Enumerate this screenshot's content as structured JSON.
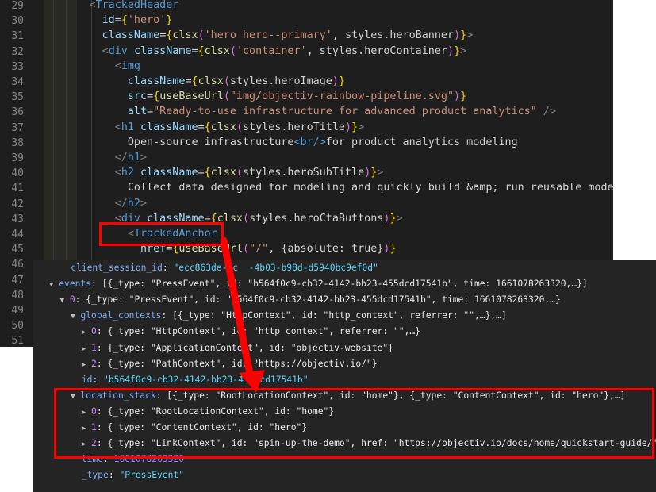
{
  "editor": {
    "line_numbers": [
      "29",
      "30",
      "31",
      "32",
      "33",
      "34",
      "35",
      "36",
      "37",
      "38",
      "39",
      "40",
      "41",
      "42",
      "43",
      "44",
      "45",
      "46",
      "47",
      "48",
      "49",
      "50",
      "51"
    ],
    "lines": [
      {
        "pre": "        ",
        "tag_open": "<",
        "tag": "TrackedHeader"
      },
      {
        "pre": "          ",
        "attr": "id",
        "eq": "=",
        "lb": "{",
        "str": "'hero'",
        "rb": "}"
      },
      {
        "pre": "          ",
        "attr": "className",
        "eq": "=",
        "lb": "{",
        "fn": "clsx",
        "p1": "(",
        "str": "'hero hero--primary'",
        "comma": ", ",
        "ref": "styles.heroBanner",
        "p2": ")",
        "rb": "}",
        "close": ">"
      },
      {
        "pre": "          ",
        "tag_open": "<",
        "tag": "div",
        "attr": "className",
        "eq": "=",
        "lb": "{",
        "fn": "clsx",
        "p1": "(",
        "str": "'container'",
        "comma": ", ",
        "ref": "styles.heroContainer",
        "p2": ")",
        "rb": "}",
        "close": ">"
      },
      {
        "pre": "            ",
        "tag_open": "<",
        "tag": "img"
      },
      {
        "pre": "              ",
        "attr": "className",
        "eq": "=",
        "lb": "{",
        "fn": "clsx",
        "p1": "(",
        "ref": "styles.heroImage",
        "p2": ")",
        "rb": "}"
      },
      {
        "pre": "              ",
        "attr": "src",
        "eq": "=",
        "lb": "{",
        "fn": "useBaseUrl",
        "p1": "(",
        "str": "\"img/objectiv-rainbow-pipeline.svg\"",
        "p2": ")",
        "rb": "}"
      },
      {
        "pre": "              ",
        "attr": "alt",
        "eq": "=",
        "str": "\"Ready-to-use infrastructure for advanced product analytics\"",
        "close": " />"
      },
      {
        "pre": "            ",
        "tag_open": "<",
        "tag": "h1",
        "attr": "className",
        "eq": "=",
        "lb": "{",
        "fn": "clsx",
        "p1": "(",
        "ref": "styles.heroTitle",
        "p2": ")",
        "rb": "}",
        "close": ">"
      },
      {
        "pre": "              ",
        "text": "Open-source infrastructure",
        "inner_tag": "<br/>",
        "text2": "for product analytics modeling"
      },
      {
        "pre": "            ",
        "tag_open": "</",
        "tag": "h1",
        "close": ">"
      },
      {
        "pre": "            ",
        "tag_open": "<",
        "tag": "h2",
        "attr": "className",
        "eq": "=",
        "lb": "{",
        "fn": "clsx",
        "p1": "(",
        "ref": "styles.heroSubTitle",
        "p2": ")",
        "rb": "}",
        "close": ">"
      },
      {
        "pre": "              ",
        "text": "Collect data designed for modeling and quickly build &amp; run reusable models."
      },
      {
        "pre": "            ",
        "tag_open": "</",
        "tag": "h2",
        "close": ">"
      },
      {
        "pre": "            ",
        "tag_open": "<",
        "tag": "div",
        "attr": "className",
        "eq": "=",
        "lb": "{",
        "fn": "clsx",
        "p1": "(",
        "ref": "styles.heroCtaButtons",
        "p2": ")",
        "rb": "}",
        "close": ">"
      },
      {
        "pre": "              ",
        "tag_open": "<",
        "tag": "TrackedAnchor"
      },
      {
        "pre": "                ",
        "attr": "href",
        "eq": "=",
        "lb": "{",
        "fn": "useBaseUrl",
        "p1": "(",
        "str": "\"/\"",
        "comma": ", ",
        "obj": "{absolute: true}",
        "p2": ")",
        "rb": "}"
      }
    ]
  },
  "console": {
    "rows": [
      {
        "indent": "  ",
        "key": "client_session_id",
        "sep": ": ",
        "val": "\"ecc863de-9c  -4b03-b98d-d5940bc9ef0d\"",
        "kind": "str"
      },
      {
        "indent": "",
        "tri": "▼",
        "key": "events",
        "sep": ": ",
        "val": "[{_type: \"PressEvent\", id: \"b564f0c9-cb32-4142-bb23-455dcd17541b\", time: 1661078263320,…}]",
        "kind": "prev"
      },
      {
        "indent": "  ",
        "tri": "▼",
        "key": "0",
        "sep": ": ",
        "val": "{_type: \"PressEvent\", id: \"b564f0c9-cb32-4142-bb23-455dcd17541b\", time: 1661078263320,…}",
        "kind": "prev"
      },
      {
        "indent": "    ",
        "tri": "▼",
        "key": "global_contexts",
        "sep": ": ",
        "val": "[{_type: \"HttpContext\", id: \"http_context\", referrer: \"\",…},…]",
        "kind": "prev"
      },
      {
        "indent": "      ",
        "tri": "▶",
        "key": "0",
        "sep": ": ",
        "val": "{_type: \"HttpContext\", id: \"http_context\", referrer: \"\",…}",
        "kind": "prev"
      },
      {
        "indent": "      ",
        "tri": "▶",
        "key": "1",
        "sep": ": ",
        "val": "{_type: \"ApplicationContext\", id: \"objectiv-website\"}",
        "kind": "prev"
      },
      {
        "indent": "      ",
        "tri": "▶",
        "key": "2",
        "sep": ": ",
        "val": "{_type: \"PathContext\", id: \"https://objectiv.io/\"}",
        "kind": "prev"
      },
      {
        "indent": "    ",
        "key": "id",
        "sep": ": ",
        "val": "\"b564f0c9-cb32-4142-bb23-455dcd17541b\"",
        "kind": "str"
      },
      {
        "indent": "    ",
        "tri": "▼",
        "key": "location_stack",
        "sep": ": ",
        "val": "[{_type: \"RootLocationContext\", id: \"home\"}, {_type: \"ContentContext\", id: \"hero\"},…]",
        "kind": "prev"
      },
      {
        "indent": "      ",
        "tri": "▶",
        "key": "0",
        "sep": ": ",
        "val": "{_type: \"RootLocationContext\", id: \"home\"}",
        "kind": "prev"
      },
      {
        "indent": "      ",
        "tri": "▶",
        "key": "1",
        "sep": ": ",
        "val": "{_type: \"ContentContext\", id: \"hero\"}",
        "kind": "prev"
      },
      {
        "indent": "      ",
        "tri": "▶",
        "key": "2",
        "sep": ": ",
        "val": "{_type: \"LinkContext\", id: \"spin-up-the-demo\", href: \"https://objectiv.io/docs/home/quickstart-guide/\"}",
        "kind": "prev"
      },
      {
        "indent": "    ",
        "key": "time",
        "sep": ": ",
        "val": "1661078263320",
        "kind": "num"
      },
      {
        "indent": "    ",
        "key": "_type",
        "sep": ": ",
        "val": "\"PressEvent\"",
        "kind": "str"
      }
    ]
  },
  "colors": {
    "highlight": "#ff0000",
    "editor_bg": "#1e1e1e",
    "console_bg": "#242424"
  }
}
